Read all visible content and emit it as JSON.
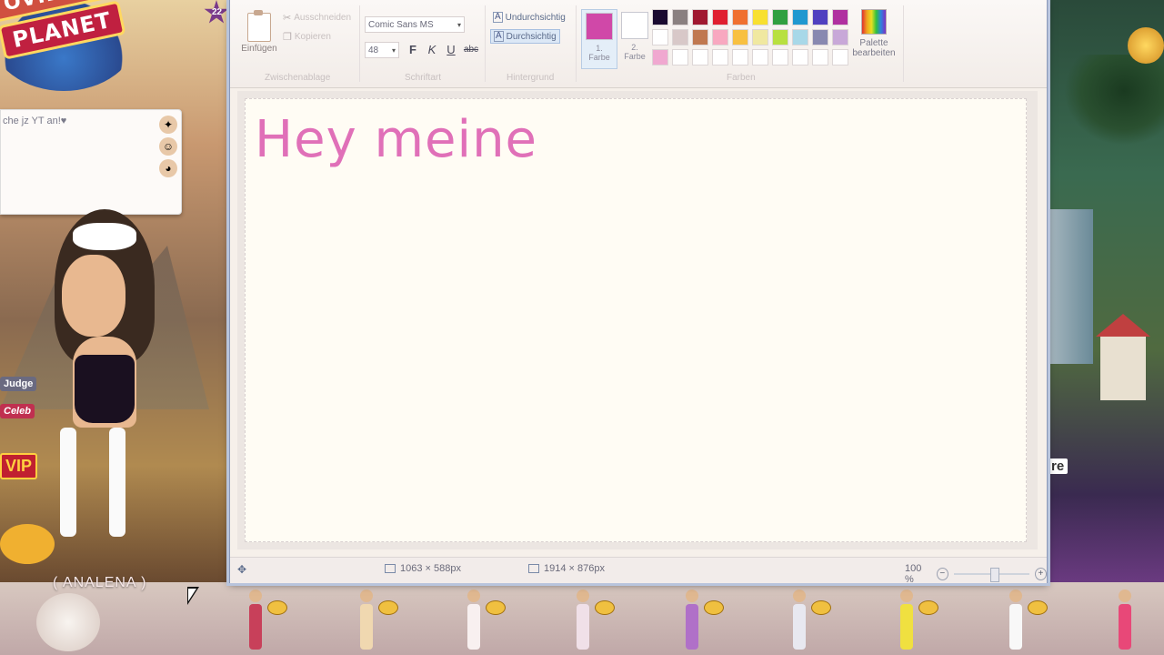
{
  "game": {
    "logo_top": "OVIESTAR",
    "logo_bottom": "PLANET",
    "level_badge": "22",
    "chat_message": "che jz YT an!♥",
    "badges": {
      "judge": "Judge",
      "celeb": "Celeb",
      "vip": "VIP"
    },
    "player_name": "( ANALENA )",
    "right_label": "re"
  },
  "paint": {
    "clipboard": {
      "paste_label": "Einfügen",
      "cut_label": "Ausschneiden",
      "copy_label": "Kopieren",
      "group_label": "Zwischenablage"
    },
    "font": {
      "family": "Comic Sans MS",
      "size": "48",
      "bold": "F",
      "italic": "K",
      "underline": "U",
      "strike": "abc",
      "group_label": "Schriftart"
    },
    "background": {
      "opaque_label": "Undurchsichtig",
      "transparent_label": "Durchsichtig",
      "group_label": "Hintergrund"
    },
    "colors": {
      "color1_label": "1.\nFarbe",
      "color2_label": "2.\nFarbe",
      "color1_value": "#d048a8",
      "color2_value": "#ffffff",
      "edit_label": "Palette bearbeiten",
      "group_label": "Farben",
      "palette": [
        "#1a0a30",
        "#8a8080",
        "#a01830",
        "#e02030",
        "#f07030",
        "#f8e030",
        "#30a040",
        "#2098d0",
        "#5040c0",
        "#b030a0",
        "#ffffff",
        "#d8c8c8",
        "#c07850",
        "#f8a8c0",
        "#f8c040",
        "#f0e8a0",
        "#b8e040",
        "#a8d8e8",
        "#8888b0",
        "#c8a8d8",
        "#f0a8d0",
        "#ffffff",
        "#ffffff",
        "#ffffff",
        "#ffffff",
        "#ffffff",
        "#ffffff",
        "#ffffff",
        "#ffffff",
        "#ffffff"
      ]
    },
    "canvas_text": "Hey meine",
    "status": {
      "selection_size": "1063 × 588px",
      "image_size": "1914 × 876px",
      "zoom": "100 %",
      "zoom_out": "−",
      "zoom_in": "+"
    }
  }
}
